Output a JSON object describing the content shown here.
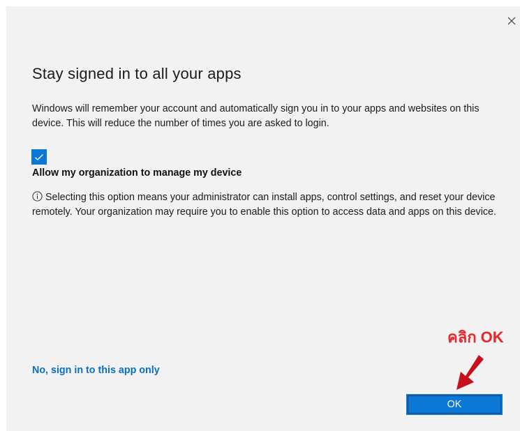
{
  "dialog": {
    "title": "Stay signed in to all your apps",
    "description": "Windows will remember your account and automatically sign you in to your apps and websites on this device. This will reduce the number of times you are asked to login.",
    "checkbox": {
      "checked": true,
      "label": "Allow my organization to manage my device"
    },
    "info_text": "Selecting this option means your administrator can install apps, control settings, and reset your device remotely. Your organization may require you to enable this option to access data and apps on this device.",
    "secondary_link": "No, sign in to this app only",
    "ok_button": "OK",
    "close_icon": "close-icon",
    "info_icon": "info-icon"
  },
  "annotation": {
    "text": "คลิก OK",
    "color": "#e8262b",
    "arrow_icon": "arrow-down-left-icon"
  },
  "colors": {
    "accent": "#0a78d4",
    "link": "#0a6fc2",
    "background": "#f2f2f2"
  }
}
